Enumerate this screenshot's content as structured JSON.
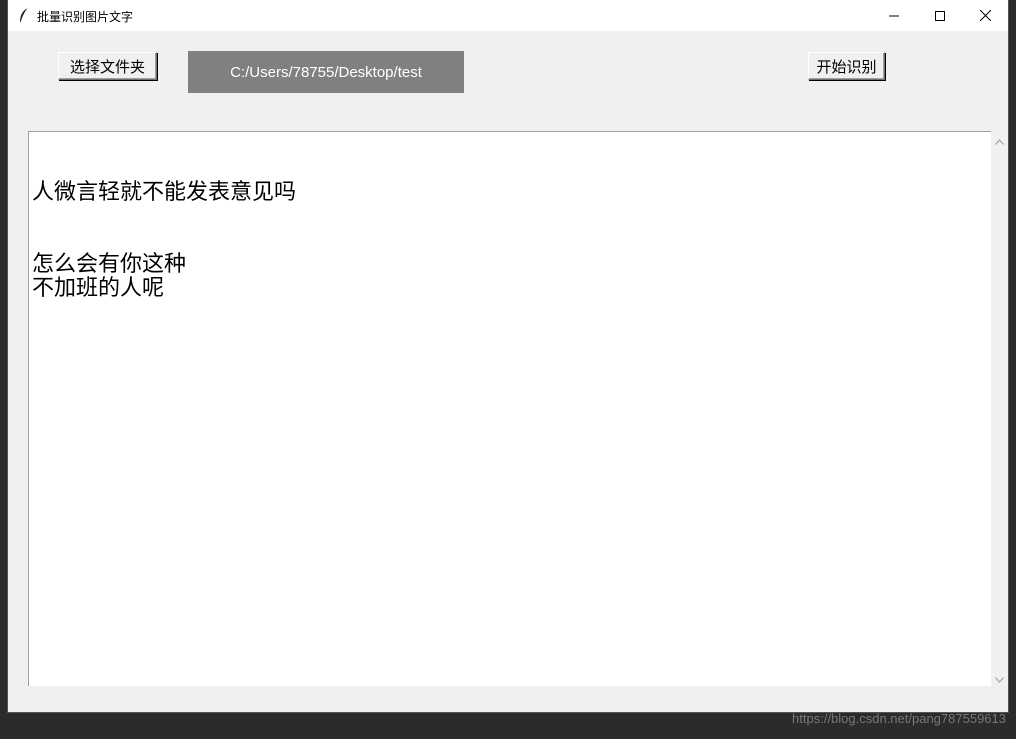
{
  "window": {
    "title": "批量识别图片文字"
  },
  "toolbar": {
    "choose_folder_label": "选择文件夹",
    "path_text": "C:/Users/78755/Desktop/test",
    "start_label": "开始识别"
  },
  "result": {
    "lines": [
      "人微言轻就不能发表意见吗",
      "怎么会有你这种",
      "不加班的人呢"
    ]
  },
  "watermark": "https://blog.csdn.net/pang787559613",
  "colors": {
    "window_bg": "#f0f0f0",
    "path_label_bg": "#808080",
    "path_label_text": "#ffffff",
    "titlebar_bg": "#ffffff"
  },
  "icons": {
    "app_icon": "feather-icon",
    "minimize": "minimize-icon",
    "maximize": "maximize-icon",
    "close": "close-icon",
    "scroll_up": "chevron-up-icon",
    "scroll_down": "chevron-down-icon"
  }
}
